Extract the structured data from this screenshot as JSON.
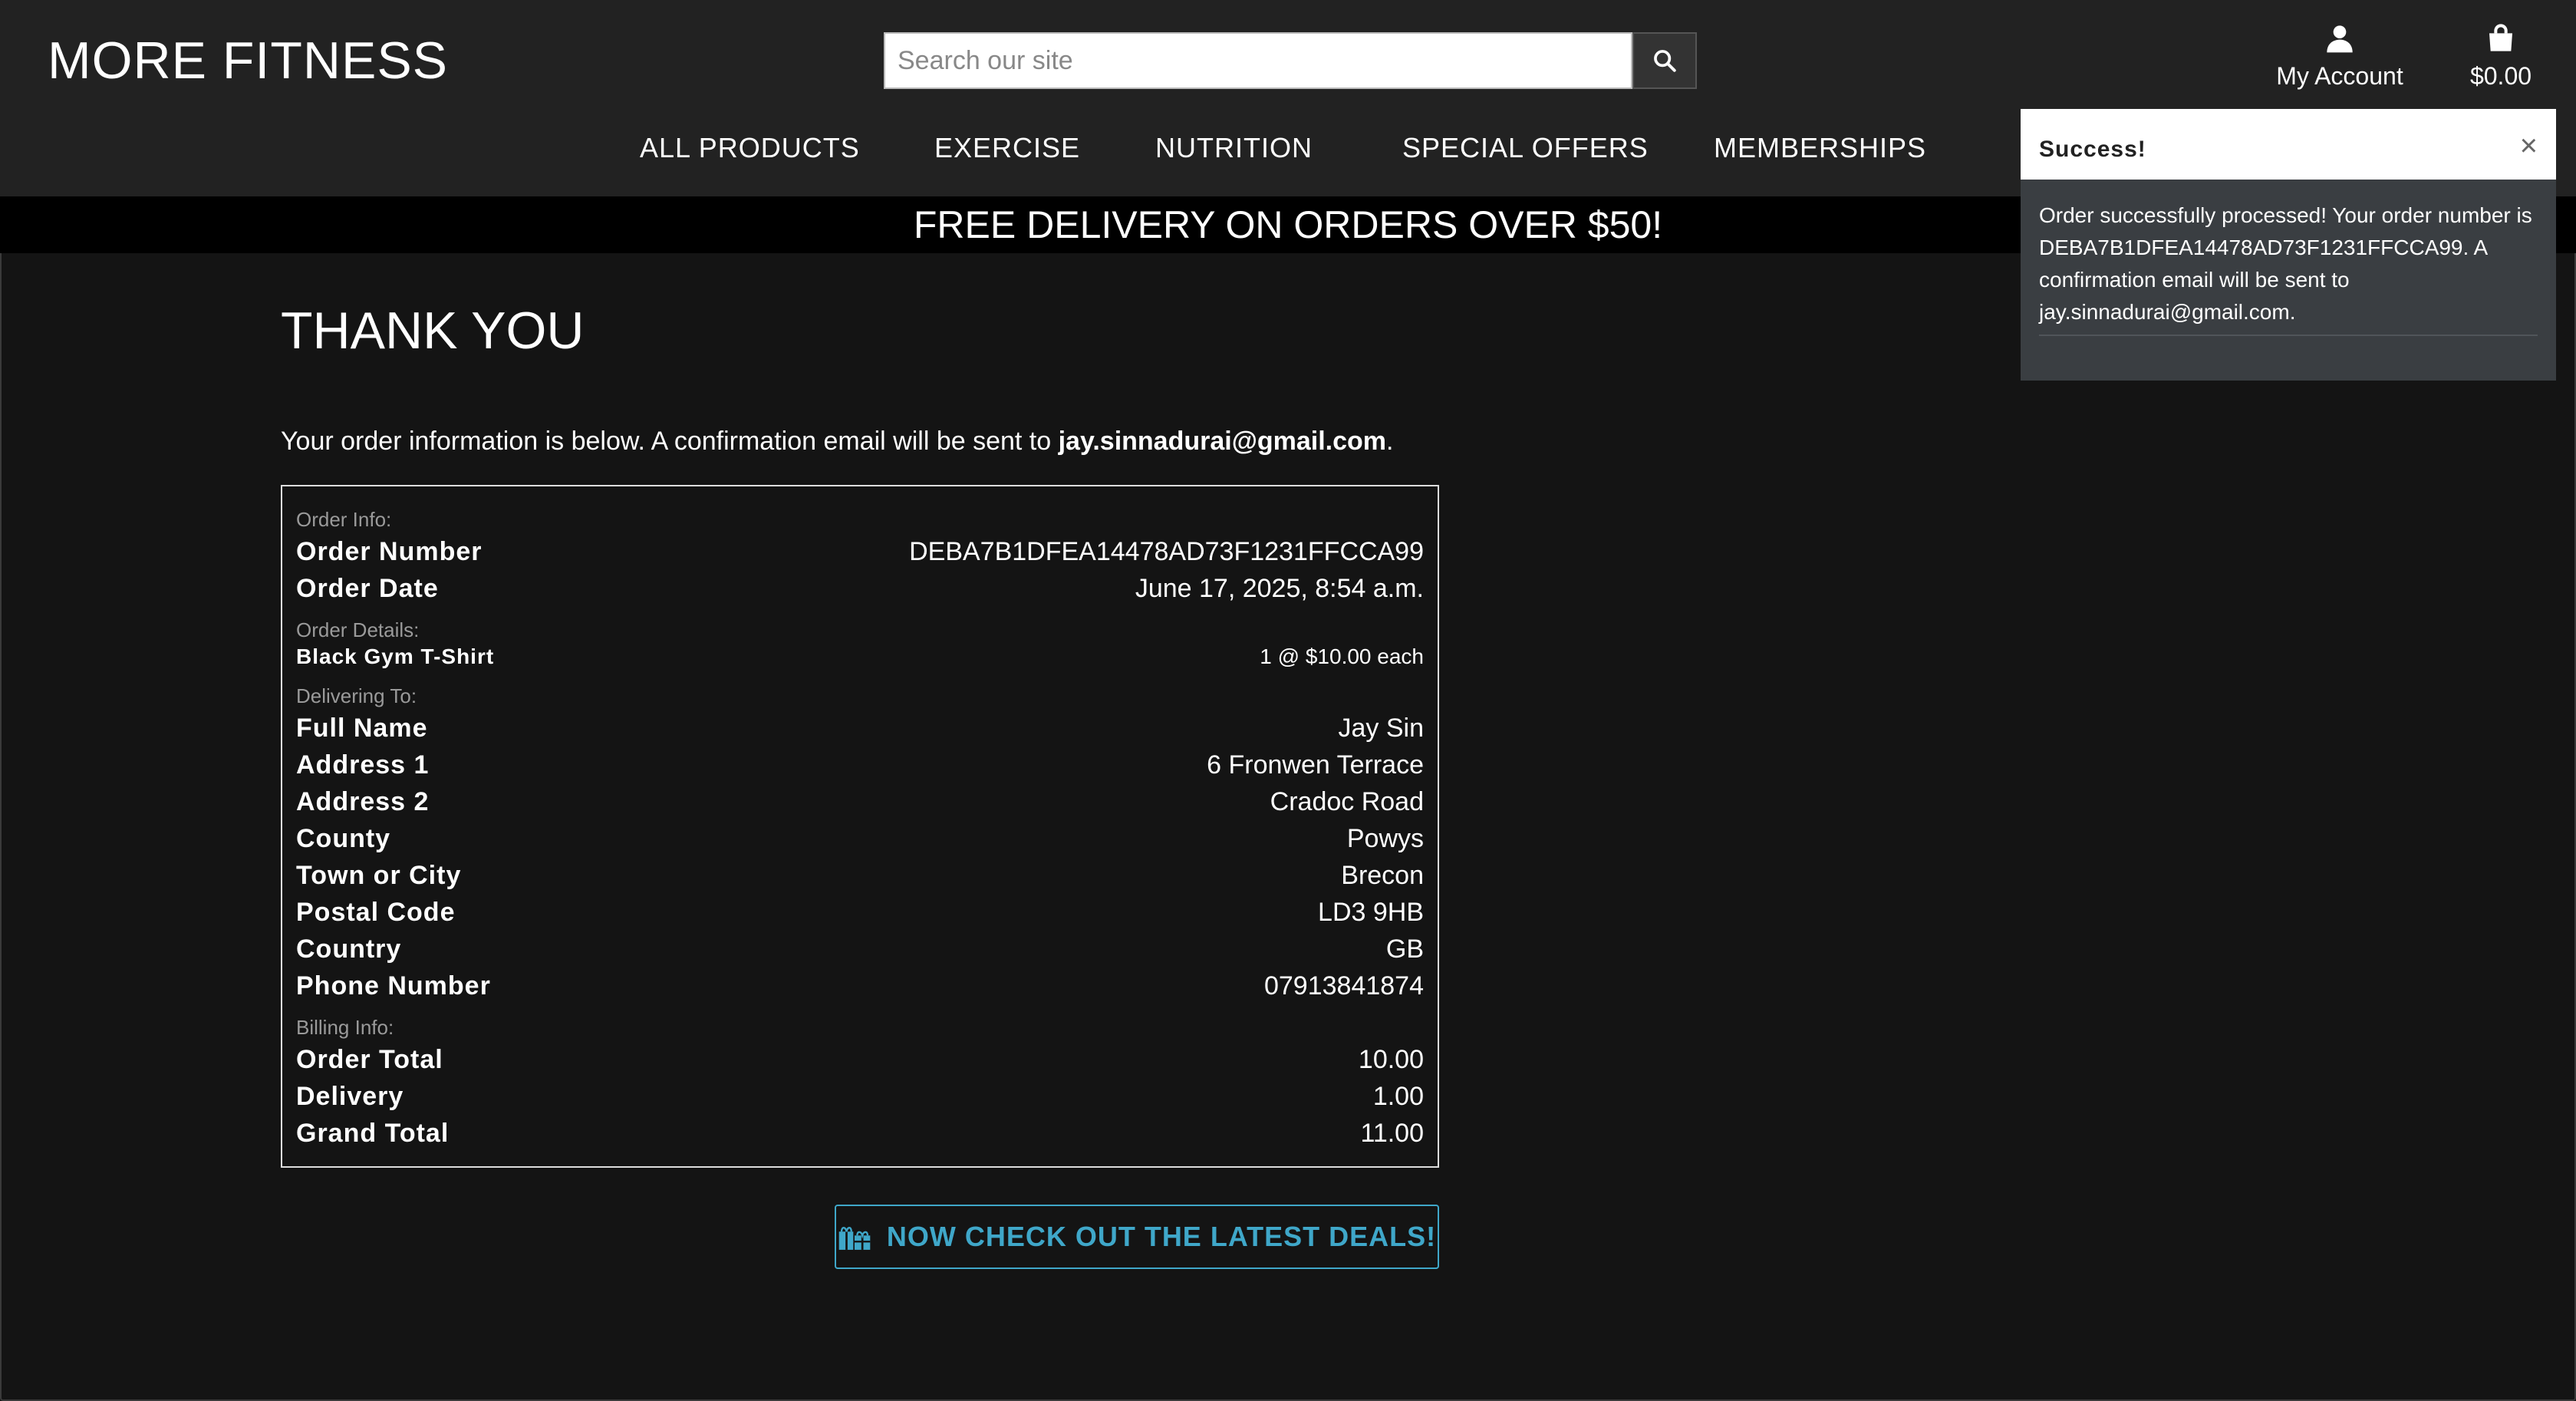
{
  "header": {
    "logo": "MORE FITNESS",
    "search_placeholder": "Search our site",
    "account_label": "My Account",
    "cart_total": "$0.00"
  },
  "nav": {
    "items": [
      "ALL PRODUCTS",
      "EXERCISE",
      "NUTRITION",
      "SPECIAL OFFERS",
      "MEMBERSHIPS"
    ]
  },
  "banner": "FREE DELIVERY ON ORDERS OVER $50!",
  "page": {
    "title": "THANK YOU",
    "intro_prefix": "Your order information is below. A confirmation email will be sent to ",
    "intro_email": "jay.sinnadurai@gmail.com",
    "intro_suffix": "."
  },
  "order": {
    "info_label": "Order Info:",
    "number_label": "Order Number",
    "number": "DEBA7B1DFEA14478AD73F1231FFCCA99",
    "date_label": "Order Date",
    "date": "June 17, 2025, 8:54 a.m.",
    "details_label": "Order Details:",
    "item_name": "Black Gym T-Shirt",
    "item_qty": "1 @ $10.00 each",
    "delivering_label": "Delivering To:",
    "delivery": [
      {
        "label": "Full Name",
        "value": "Jay Sin"
      },
      {
        "label": "Address 1",
        "value": "6 Fronwen Terrace"
      },
      {
        "label": "Address 2",
        "value": "Cradoc Road"
      },
      {
        "label": "County",
        "value": "Powys"
      },
      {
        "label": "Town or City",
        "value": "Brecon"
      },
      {
        "label": "Postal Code",
        "value": "LD3 9HB"
      },
      {
        "label": "Country",
        "value": "GB"
      },
      {
        "label": "Phone Number",
        "value": "07913841874"
      }
    ],
    "billing_label": "Billing Info:",
    "billing": [
      {
        "label": "Order Total",
        "value": "10.00"
      },
      {
        "label": "Delivery",
        "value": "1.00"
      },
      {
        "label": "Grand Total",
        "value": "11.00"
      }
    ]
  },
  "deals_button": "NOW CHECK OUT THE LATEST DEALS!",
  "toast": {
    "title": "Success!",
    "close": "×",
    "message": "Order successfully processed! Your order number is DEBA7B1DFEA14478AD73F1231FFCCA99. A confirmation email will be sent to jay.sinnadurai@gmail.com."
  },
  "colors": {
    "background": "#141414",
    "header": "#222222",
    "accent": "#3fa7c9",
    "toast_body": "#3a3e42"
  }
}
